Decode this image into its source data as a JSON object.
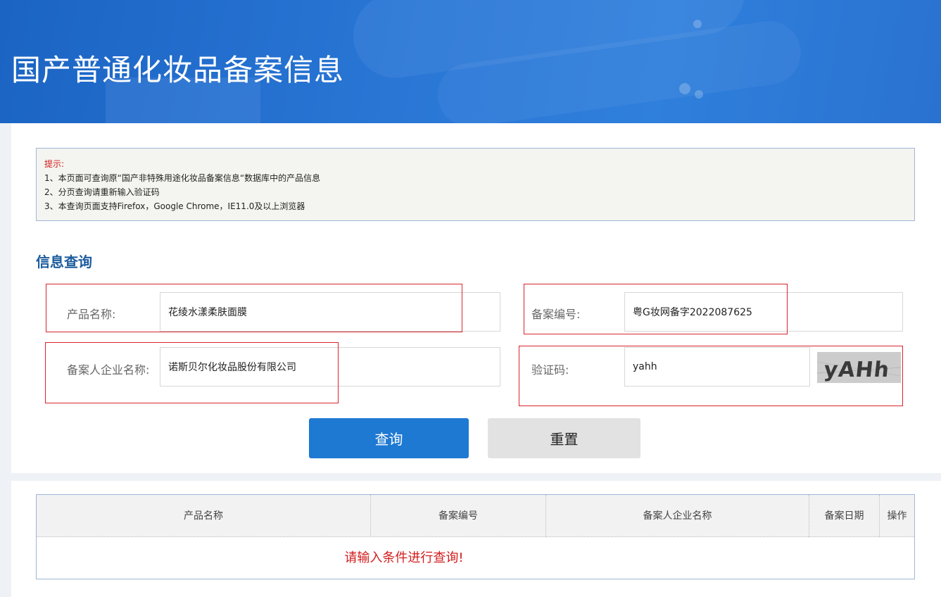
{
  "header": {
    "title": "国产普通化妆品备案信息"
  },
  "notice": {
    "title": "提示:",
    "lines": [
      "1、本页面可查询原“国产非特殊用途化妆品备案信息“数据库中的产品信息",
      "2、分页查询请重新输入验证码",
      "3、本查询页面支持Firefox，Google Chrome，IE11.0及以上浏览器"
    ]
  },
  "search": {
    "section_title": "信息查询",
    "product_name_label": "产品名称:",
    "product_name_value": "花绫水漾柔肤面膜",
    "record_no_label": "备案编号:",
    "record_no_value": "粤G妆网备字2022087625",
    "company_label": "备案人企业名称:",
    "company_value": "诺斯贝尔化妆品股份有限公司",
    "captcha_label": "验证码:",
    "captcha_value": "yahh",
    "captcha_image_text": "yAHh",
    "query_button": "查询",
    "reset_button": "重置"
  },
  "results": {
    "columns": [
      "产品名称",
      "备案编号",
      "备案人企业名称",
      "备案日期",
      "操作"
    ],
    "empty_message": "请输入条件进行查询!"
  },
  "colors": {
    "banner": "#2a77d6",
    "primary_button": "#1e79d3",
    "section_title": "#1c5c9e",
    "alert_red": "#d21c1c"
  }
}
